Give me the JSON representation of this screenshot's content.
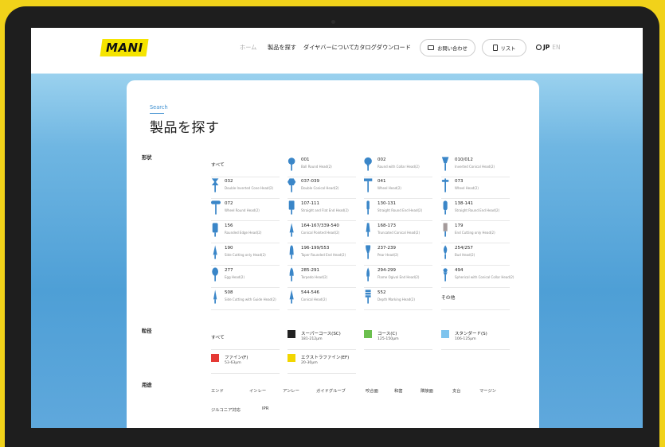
{
  "header": {
    "logo_text": "MANI",
    "nav": {
      "home": "ホーム",
      "search": "製品を探す",
      "about": "ダイヤバーについて",
      "catalog": "カタログダウンロード"
    },
    "contact_label": "お問い合わせ",
    "list_label": "リスト",
    "lang_jp": "JP",
    "lang_en": "EN"
  },
  "page": {
    "eyebrow": "Search",
    "title": "製品を探す"
  },
  "sections": {
    "shape": "形状",
    "grit": "粒径",
    "use": "用途"
  },
  "shapes": [
    {
      "code": "すべて",
      "desc": "",
      "icon": "none"
    },
    {
      "code": "001",
      "desc": "Ball Round Head(2)",
      "icon": "ball"
    },
    {
      "code": "002",
      "desc": "Round with Collar Head(2)",
      "icon": "ball-collar"
    },
    {
      "code": "010/012",
      "desc": "Inverted Conical Head(2)",
      "icon": "inverted-cone"
    },
    {
      "code": "032",
      "desc": "Double Inverted Cone Head(2)",
      "icon": "double-cone"
    },
    {
      "code": "037-039",
      "desc": "Double Conical Head(2)",
      "icon": "double-conical"
    },
    {
      "code": "041",
      "desc": "Wheel Head(2)",
      "icon": "wheel-t"
    },
    {
      "code": "073",
      "desc": "Wheel Head(2)",
      "icon": "wheel-small"
    },
    {
      "code": "072",
      "desc": "Wheel Round Head(2)",
      "icon": "wheel-round"
    },
    {
      "code": "107-111",
      "desc": "Straight and Flat End Head(2)",
      "icon": "cylinder"
    },
    {
      "code": "130-131",
      "desc": "Straight Round End Head(2)",
      "icon": "cylinder-thin"
    },
    {
      "code": "138-141",
      "desc": "Straight Round End Head(2)",
      "icon": "cylinder-round"
    },
    {
      "code": "156",
      "desc": "Rounded Edge Head(2)",
      "icon": "cylinder-wide"
    },
    {
      "code": "164-167/339-540",
      "desc": "Conical Pointed Head(2)",
      "icon": "cone-point"
    },
    {
      "code": "168-173",
      "desc": "Truncated Conical Head(2)",
      "icon": "truncated-cone"
    },
    {
      "code": "179",
      "desc": "End Cutting only Head(2)",
      "icon": "end-cutting"
    },
    {
      "code": "190",
      "desc": "Side Cutting only Head(2)",
      "icon": "side-cutting"
    },
    {
      "code": "196-199/553",
      "desc": "Taper Rounded End Head(2)",
      "icon": "taper-round"
    },
    {
      "code": "237-239",
      "desc": "Pear Head(2)",
      "icon": "pear"
    },
    {
      "code": "254/257",
      "desc": "Bud Head(2)",
      "icon": "bud"
    },
    {
      "code": "277",
      "desc": "Egg Head(2)",
      "icon": "egg"
    },
    {
      "code": "285-291",
      "desc": "Torpedo Head(2)",
      "icon": "torpedo"
    },
    {
      "code": "294-299",
      "desc": "Flame Ogival End Head(2)",
      "icon": "flame"
    },
    {
      "code": "494",
      "desc": "Spherical with Conical Collar Head(2)",
      "icon": "sphere-collar"
    },
    {
      "code": "508",
      "desc": "Side Cutting with Guide Head(2)",
      "icon": "guide"
    },
    {
      "code": "544-546",
      "desc": "Conical Head(2)",
      "icon": "conical"
    },
    {
      "code": "552",
      "desc": "Depth Marking Head(2)",
      "icon": "depth"
    },
    {
      "code": "その他",
      "desc": "",
      "icon": "none"
    }
  ],
  "grits": [
    {
      "name": "すべて",
      "range": "",
      "color": ""
    },
    {
      "name": "スーパーコース(SC)",
      "range": "181-212µm",
      "color": "#222222"
    },
    {
      "name": "コース(C)",
      "range": "125-150µm",
      "color": "#6bbf4e"
    },
    {
      "name": "スタンダード(S)",
      "range": "106-125µm",
      "color": "#7ec4ee"
    },
    {
      "name": "ファイン(F)",
      "range": "53-63µm",
      "color": "#e53935"
    },
    {
      "name": "エクストラファイン(EF)",
      "range": "20-30µm",
      "color": "#f2d600"
    }
  ],
  "uses": [
    "エンド",
    "インレー",
    "アンレー",
    "ガイドグルーブ",
    "咬合面",
    "和歯",
    "隣接面",
    "支台",
    "マージン",
    "ジルコニア対応",
    "IPR"
  ],
  "colors": {
    "bur_blue": "#3a86c8",
    "end_cutting_gray": "#a49a9a",
    "accent": "#3d8fd0",
    "logo_yellow": "#f5e400",
    "frame_yellow": "#f1d21a"
  }
}
